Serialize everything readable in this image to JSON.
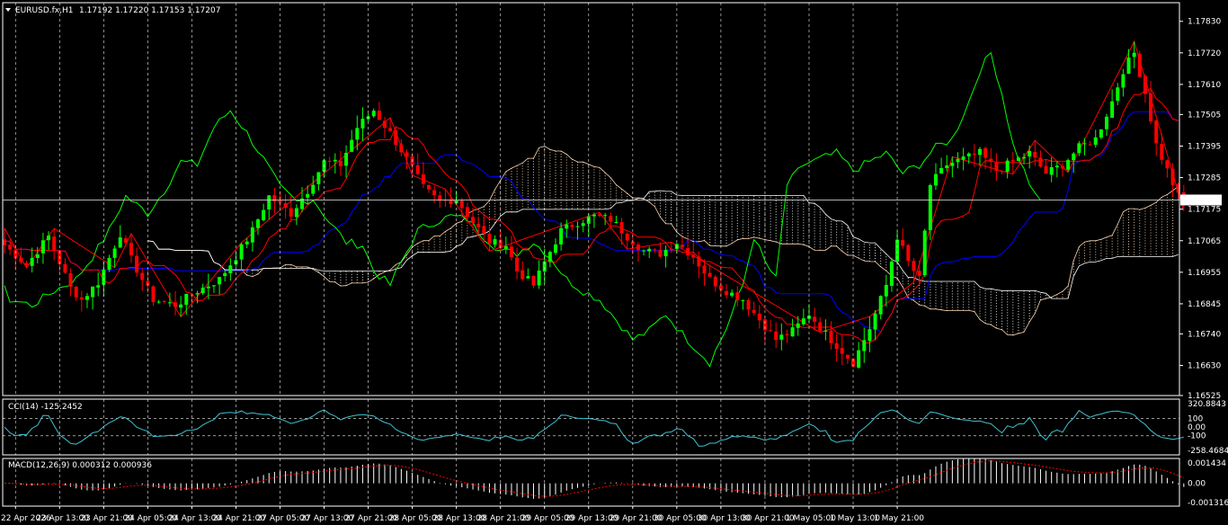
{
  "window": {
    "symbol_caption": "EURUSD.fx,H1",
    "ohlc": "1.17192 1.17220 1.17153 1.17207"
  },
  "colors": {
    "background": "#000000",
    "grid": "#ffffff",
    "bull_candle": "#00ff00",
    "bear_candle": "#ff0000",
    "tenkan": "#ff0000",
    "kijun": "#0000ff",
    "chikou": "#00ff00",
    "senkou_a": "#ffd9b3",
    "senkou_b": "#ffffff",
    "zigzag": "#ff0000",
    "cci_line": "#40c0d0",
    "macd_hist": "#ffffff",
    "macd_signal": "#ff0000",
    "current_price_bg": "#ffffff"
  },
  "chart_data": [
    {
      "type": "candlestick",
      "name": "main",
      "ylim": [
        1.16525,
        1.17895
      ],
      "y_ticks": [
        "1.17830",
        "1.17720",
        "1.17610",
        "1.17505",
        "1.17395",
        "1.17285",
        "1.17175",
        "1.17065",
        "1.16955",
        "1.16845",
        "1.16740",
        "1.16630",
        "1.16525"
      ],
      "current_price": "1.17207",
      "x_labels": [
        "22 Apr 2026",
        "23 Apr 13:00",
        "23 Apr 21:00",
        "24 Apr 05:00",
        "24 Apr 13:00",
        "24 Apr 21:00",
        "27 Apr 05:00",
        "27 Apr 13:00",
        "27 Apr 21:00",
        "28 Apr 05:00",
        "28 Apr 13:00",
        "28 Apr 21:00",
        "29 Apr 05:00",
        "29 Apr 13:00",
        "29 Apr 21:00",
        "30 Apr 05:00",
        "30 Apr 13:00",
        "30 Apr 21:00",
        "1 May 05:00",
        "1 May 13:00",
        "1 May 21:00"
      ],
      "close_anchors": [
        [
          0,
          1.1705
        ],
        [
          4,
          1.1698
        ],
        [
          8,
          1.1708
        ],
        [
          12,
          1.169
        ],
        [
          14,
          1.1686
        ],
        [
          17,
          1.1692
        ],
        [
          21,
          1.1709
        ],
        [
          23,
          1.17
        ],
        [
          27,
          1.1686
        ],
        [
          31,
          1.1684
        ],
        [
          35,
          1.1689
        ],
        [
          39,
          1.1693
        ],
        [
          42,
          1.1701
        ],
        [
          45,
          1.171
        ],
        [
          48,
          1.1722
        ],
        [
          52,
          1.1716
        ],
        [
          55,
          1.1724
        ],
        [
          58,
          1.1734
        ],
        [
          61,
          1.1733
        ],
        [
          64,
          1.1746
        ],
        [
          67,
          1.1752
        ],
        [
          70,
          1.1744
        ],
        [
          73,
          1.1735
        ],
        [
          76,
          1.1725
        ],
        [
          79,
          1.172
        ],
        [
          82,
          1.1721
        ],
        [
          85,
          1.1713
        ],
        [
          88,
          1.1706
        ],
        [
          91,
          1.1705
        ],
        [
          93,
          1.1696
        ],
        [
          96,
          1.1691
        ],
        [
          98,
          1.1699
        ],
        [
          101,
          1.171
        ],
        [
          104,
          1.1713
        ],
        [
          107,
          1.1715
        ],
        [
          110,
          1.1714
        ],
        [
          113,
          1.1708
        ],
        [
          116,
          1.1703
        ],
        [
          119,
          1.1702
        ],
        [
          122,
          1.1706
        ],
        [
          125,
          1.1701
        ],
        [
          128,
          1.1693
        ],
        [
          131,
          1.1689
        ],
        [
          134,
          1.1686
        ],
        [
          137,
          1.1679
        ],
        [
          140,
          1.1672
        ],
        [
          143,
          1.1675
        ],
        [
          146,
          1.1681
        ],
        [
          149,
          1.1674
        ],
        [
          152,
          1.1668
        ],
        [
          154,
          1.1664
        ],
        [
          157,
          1.1676
        ],
        [
          160,
          1.1691
        ],
        [
          162,
          1.1708
        ],
        [
          164,
          1.1699
        ],
        [
          166,
          1.1693
        ],
        [
          168,
          1.1726
        ],
        [
          171,
          1.1733
        ],
        [
          174,
          1.1735
        ],
        [
          177,
          1.1737
        ],
        [
          180,
          1.1731
        ],
        [
          183,
          1.1734
        ],
        [
          186,
          1.1737
        ],
        [
          189,
          1.173
        ],
        [
          192,
          1.1733
        ],
        [
          195,
          1.1739
        ],
        [
          198,
          1.1742
        ],
        [
          201,
          1.1755
        ],
        [
          203,
          1.1766
        ],
        [
          205,
          1.1772
        ],
        [
          207,
          1.1758
        ],
        [
          209,
          1.174
        ],
        [
          211,
          1.1731
        ],
        [
          213,
          1.1722
        ],
        [
          214,
          1.17207
        ]
      ],
      "series": [
        {
          "name": "Tenkan-sen",
          "window": 9
        },
        {
          "name": "Kijun-sen",
          "window": 26
        },
        {
          "name": "Chikou Span",
          "shift": -26
        },
        {
          "name": "Senkou Span A",
          "shift": 26
        },
        {
          "name": "Senkou Span B",
          "window": 52,
          "shift": 26
        },
        {
          "name": "ZigZag"
        }
      ]
    },
    {
      "type": "line",
      "name": "CCI(14)",
      "caption": "CCI(14) -125.2452",
      "ylim": [
        -320,
        320.8843
      ],
      "y_labels": {
        "top": "320.8843",
        "upper": "100",
        "zero": "0.00",
        "lower": "-100",
        "bottom": "-258.4684"
      }
    },
    {
      "type": "histogram",
      "name": "MACD(12,26,9)",
      "caption": "MACD(12,26,9) 0.000312 0.000936",
      "ylim": [
        -0.001316,
        0.001434
      ],
      "y_labels": {
        "top": "0.001434",
        "zero": "0.00",
        "bottom": "-0.001316"
      }
    }
  ]
}
